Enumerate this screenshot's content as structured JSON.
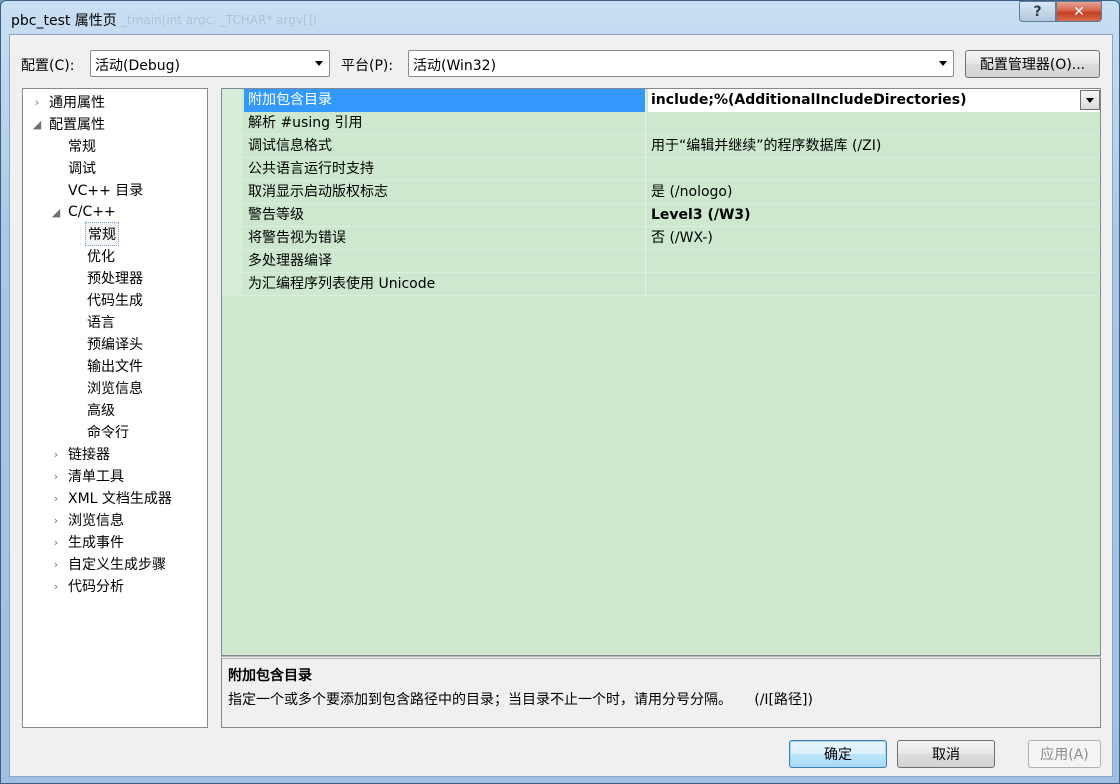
{
  "window": {
    "title": "pbc_test 属性页",
    "ghost_title": "_tmain(int argc, _TCHAR* argv[])",
    "help_glyph": "?",
    "close_glyph": "✕"
  },
  "toolbar": {
    "config_label": "配置(C):",
    "config_value": "活动(Debug)",
    "platform_label": "平台(P):",
    "platform_value": "活动(Win32)",
    "config_manager": "配置管理器(O)..."
  },
  "tree": [
    {
      "label": "通用属性",
      "toggle": "›",
      "level": 0
    },
    {
      "label": "配置属性",
      "toggle": "◢",
      "level": 0
    },
    {
      "label": "常规",
      "toggle": "",
      "level": 1
    },
    {
      "label": "调试",
      "toggle": "",
      "level": 1
    },
    {
      "label": "VC++ 目录",
      "toggle": "",
      "level": 1
    },
    {
      "label": "C/C++",
      "toggle": "◢",
      "level": 1
    },
    {
      "label": "常规",
      "toggle": "",
      "level": 2,
      "selected": true
    },
    {
      "label": "优化",
      "toggle": "",
      "level": 2
    },
    {
      "label": "预处理器",
      "toggle": "",
      "level": 2
    },
    {
      "label": "代码生成",
      "toggle": "",
      "level": 2
    },
    {
      "label": "语言",
      "toggle": "",
      "level": 2
    },
    {
      "label": "预编译头",
      "toggle": "",
      "level": 2
    },
    {
      "label": "输出文件",
      "toggle": "",
      "level": 2
    },
    {
      "label": "浏览信息",
      "toggle": "",
      "level": 2
    },
    {
      "label": "高级",
      "toggle": "",
      "level": 2
    },
    {
      "label": "命令行",
      "toggle": "",
      "level": 2
    },
    {
      "label": "链接器",
      "toggle": "›",
      "level": 1
    },
    {
      "label": "清单工具",
      "toggle": "›",
      "level": 1
    },
    {
      "label": "XML 文档生成器",
      "toggle": "›",
      "level": 1
    },
    {
      "label": "浏览信息",
      "toggle": "›",
      "level": 1
    },
    {
      "label": "生成事件",
      "toggle": "›",
      "level": 1
    },
    {
      "label": "自定义生成步骤",
      "toggle": "›",
      "level": 1
    },
    {
      "label": "代码分析",
      "toggle": "›",
      "level": 1
    }
  ],
  "properties": [
    {
      "name": "附加包含目录",
      "value": "include;%(AdditionalIncludeDirectories)",
      "selected": true
    },
    {
      "name": "解析 #using 引用",
      "value": ""
    },
    {
      "name": "调试信息格式",
      "value": "用于“编辑并继续”的程序数据库 (/ZI)"
    },
    {
      "name": "公共语言运行时支持",
      "value": ""
    },
    {
      "name": "取消显示启动版权标志",
      "value": "是 (/nologo)"
    },
    {
      "name": "警告等级",
      "value": "Level3 (/W3)",
      "bold": true
    },
    {
      "name": "将警告视为错误",
      "value": "否 (/WX-)"
    },
    {
      "name": "多处理器编译",
      "value": ""
    },
    {
      "name": "为汇编程序列表使用 Unicode",
      "value": ""
    }
  ],
  "description": {
    "title": "附加包含目录",
    "text": "指定一个或多个要添加到包含路径中的目录；当目录不止一个时，请用分号分隔。     (/I[路径])"
  },
  "buttons": {
    "ok": "确定",
    "cancel": "取消",
    "apply": "应用(A)"
  }
}
